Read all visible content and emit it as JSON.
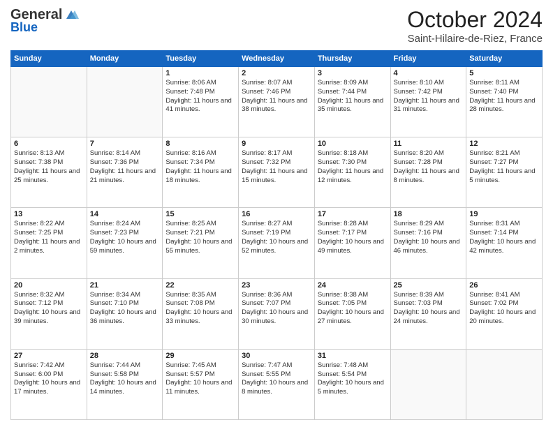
{
  "header": {
    "logo_general": "General",
    "logo_blue": "Blue",
    "month": "October 2024",
    "location": "Saint-Hilaire-de-Riez, France"
  },
  "days_of_week": [
    "Sunday",
    "Monday",
    "Tuesday",
    "Wednesday",
    "Thursday",
    "Friday",
    "Saturday"
  ],
  "weeks": [
    [
      {
        "day": "",
        "info": ""
      },
      {
        "day": "",
        "info": ""
      },
      {
        "day": "1",
        "info": "Sunrise: 8:06 AM\nSunset: 7:48 PM\nDaylight: 11 hours and 41 minutes."
      },
      {
        "day": "2",
        "info": "Sunrise: 8:07 AM\nSunset: 7:46 PM\nDaylight: 11 hours and 38 minutes."
      },
      {
        "day": "3",
        "info": "Sunrise: 8:09 AM\nSunset: 7:44 PM\nDaylight: 11 hours and 35 minutes."
      },
      {
        "day": "4",
        "info": "Sunrise: 8:10 AM\nSunset: 7:42 PM\nDaylight: 11 hours and 31 minutes."
      },
      {
        "day": "5",
        "info": "Sunrise: 8:11 AM\nSunset: 7:40 PM\nDaylight: 11 hours and 28 minutes."
      }
    ],
    [
      {
        "day": "6",
        "info": "Sunrise: 8:13 AM\nSunset: 7:38 PM\nDaylight: 11 hours and 25 minutes."
      },
      {
        "day": "7",
        "info": "Sunrise: 8:14 AM\nSunset: 7:36 PM\nDaylight: 11 hours and 21 minutes."
      },
      {
        "day": "8",
        "info": "Sunrise: 8:16 AM\nSunset: 7:34 PM\nDaylight: 11 hours and 18 minutes."
      },
      {
        "day": "9",
        "info": "Sunrise: 8:17 AM\nSunset: 7:32 PM\nDaylight: 11 hours and 15 minutes."
      },
      {
        "day": "10",
        "info": "Sunrise: 8:18 AM\nSunset: 7:30 PM\nDaylight: 11 hours and 12 minutes."
      },
      {
        "day": "11",
        "info": "Sunrise: 8:20 AM\nSunset: 7:28 PM\nDaylight: 11 hours and 8 minutes."
      },
      {
        "day": "12",
        "info": "Sunrise: 8:21 AM\nSunset: 7:27 PM\nDaylight: 11 hours and 5 minutes."
      }
    ],
    [
      {
        "day": "13",
        "info": "Sunrise: 8:22 AM\nSunset: 7:25 PM\nDaylight: 11 hours and 2 minutes."
      },
      {
        "day": "14",
        "info": "Sunrise: 8:24 AM\nSunset: 7:23 PM\nDaylight: 10 hours and 59 minutes."
      },
      {
        "day": "15",
        "info": "Sunrise: 8:25 AM\nSunset: 7:21 PM\nDaylight: 10 hours and 55 minutes."
      },
      {
        "day": "16",
        "info": "Sunrise: 8:27 AM\nSunset: 7:19 PM\nDaylight: 10 hours and 52 minutes."
      },
      {
        "day": "17",
        "info": "Sunrise: 8:28 AM\nSunset: 7:17 PM\nDaylight: 10 hours and 49 minutes."
      },
      {
        "day": "18",
        "info": "Sunrise: 8:29 AM\nSunset: 7:16 PM\nDaylight: 10 hours and 46 minutes."
      },
      {
        "day": "19",
        "info": "Sunrise: 8:31 AM\nSunset: 7:14 PM\nDaylight: 10 hours and 42 minutes."
      }
    ],
    [
      {
        "day": "20",
        "info": "Sunrise: 8:32 AM\nSunset: 7:12 PM\nDaylight: 10 hours and 39 minutes."
      },
      {
        "day": "21",
        "info": "Sunrise: 8:34 AM\nSunset: 7:10 PM\nDaylight: 10 hours and 36 minutes."
      },
      {
        "day": "22",
        "info": "Sunrise: 8:35 AM\nSunset: 7:08 PM\nDaylight: 10 hours and 33 minutes."
      },
      {
        "day": "23",
        "info": "Sunrise: 8:36 AM\nSunset: 7:07 PM\nDaylight: 10 hours and 30 minutes."
      },
      {
        "day": "24",
        "info": "Sunrise: 8:38 AM\nSunset: 7:05 PM\nDaylight: 10 hours and 27 minutes."
      },
      {
        "day": "25",
        "info": "Sunrise: 8:39 AM\nSunset: 7:03 PM\nDaylight: 10 hours and 24 minutes."
      },
      {
        "day": "26",
        "info": "Sunrise: 8:41 AM\nSunset: 7:02 PM\nDaylight: 10 hours and 20 minutes."
      }
    ],
    [
      {
        "day": "27",
        "info": "Sunrise: 7:42 AM\nSunset: 6:00 PM\nDaylight: 10 hours and 17 minutes."
      },
      {
        "day": "28",
        "info": "Sunrise: 7:44 AM\nSunset: 5:58 PM\nDaylight: 10 hours and 14 minutes."
      },
      {
        "day": "29",
        "info": "Sunrise: 7:45 AM\nSunset: 5:57 PM\nDaylight: 10 hours and 11 minutes."
      },
      {
        "day": "30",
        "info": "Sunrise: 7:47 AM\nSunset: 5:55 PM\nDaylight: 10 hours and 8 minutes."
      },
      {
        "day": "31",
        "info": "Sunrise: 7:48 AM\nSunset: 5:54 PM\nDaylight: 10 hours and 5 minutes."
      },
      {
        "day": "",
        "info": ""
      },
      {
        "day": "",
        "info": ""
      }
    ]
  ]
}
